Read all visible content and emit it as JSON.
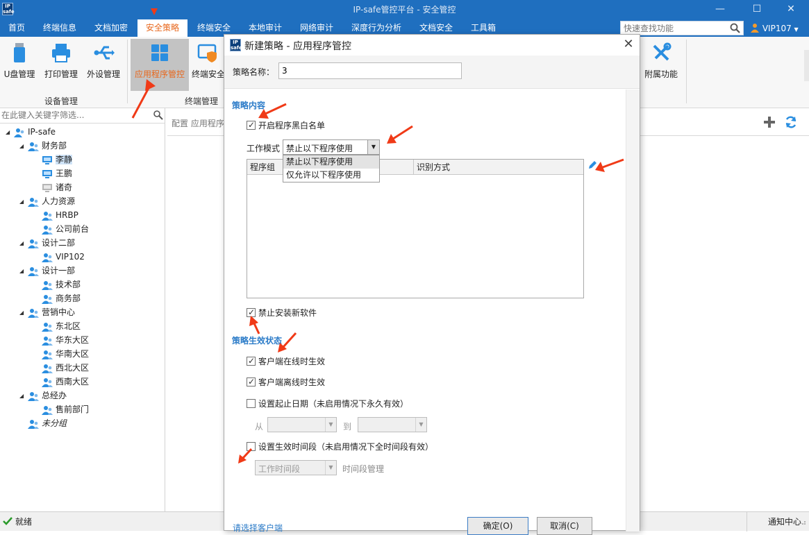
{
  "window": {
    "title": "IP-safe管控平台 - 安全管控",
    "logo": "IP safe"
  },
  "menu": {
    "items": [
      "首页",
      "终端信息",
      "文档加密",
      "安全策略",
      "终端安全",
      "本地审计",
      "网络审计",
      "深度行为分析",
      "文档安全",
      "工具箱"
    ],
    "active": "安全策略"
  },
  "search": {
    "placeholder": "快速查找功能"
  },
  "user": {
    "name": "VIP107"
  },
  "ribbon": {
    "buttons": [
      "U盘管理",
      "打印管理",
      "外设管理",
      "应用程序管控",
      "终端安全",
      "附属功能"
    ],
    "groups": [
      "设备管理",
      "终端管理"
    ]
  },
  "tree": {
    "filter_placeholder": "在此键入关键字筛选...",
    "nodes": [
      {
        "label": "IP-safe",
        "level": 0,
        "icon": "root-icon"
      },
      {
        "label": "财务部",
        "level": 1,
        "icon": "group-icon"
      },
      {
        "label": "李静",
        "level": 2,
        "icon": "computer-icon",
        "selected": true
      },
      {
        "label": "王鹏",
        "level": 2,
        "icon": "computer-icon"
      },
      {
        "label": "诸奇",
        "level": 2,
        "icon": "computer-offline-icon"
      },
      {
        "label": "人力资源",
        "level": 1,
        "icon": "group-icon"
      },
      {
        "label": "HRBP",
        "level": 2,
        "icon": "group-icon"
      },
      {
        "label": "公司前台",
        "level": 2,
        "icon": "group-icon"
      },
      {
        "label": "设计二部",
        "level": 1,
        "icon": "group-icon"
      },
      {
        "label": "VIP102",
        "level": 2,
        "icon": "group-icon"
      },
      {
        "label": "设计一部",
        "level": 1,
        "icon": "group-icon"
      },
      {
        "label": "技术部",
        "level": 2,
        "icon": "group-icon"
      },
      {
        "label": "商务部",
        "level": 2,
        "icon": "group-icon"
      },
      {
        "label": "营销中心",
        "level": 1,
        "icon": "group-icon"
      },
      {
        "label": "东北区",
        "level": 2,
        "icon": "group-icon"
      },
      {
        "label": "华东大区",
        "level": 2,
        "icon": "group-icon"
      },
      {
        "label": "华南大区",
        "level": 2,
        "icon": "group-icon"
      },
      {
        "label": "西北大区",
        "level": 2,
        "icon": "group-icon"
      },
      {
        "label": "西南大区",
        "level": 2,
        "icon": "group-icon"
      },
      {
        "label": "总经办",
        "level": 1,
        "icon": "group-icon"
      },
      {
        "label": "售前部门",
        "level": 2,
        "icon": "group-icon"
      },
      {
        "label": "未分组",
        "level": 1,
        "icon": "group-icon",
        "italic": true
      }
    ]
  },
  "content": {
    "breadcrumb": "配置 应用程序"
  },
  "dialog": {
    "title": "新建策略 - 应用程序管控",
    "name_label": "策略名称：",
    "name_value": "3",
    "section_content": "策略内容",
    "enable_blacklist": "开启程序黑白名单",
    "mode_label": "工作模式",
    "mode_value": "禁止以下程序使用",
    "mode_options": [
      "禁止以下程序使用",
      "仅允许以下程序使用"
    ],
    "columns": [
      "程序组",
      "识别方式"
    ],
    "ban_install": "禁止安装新软件",
    "section_status": "策略生效状态",
    "online": "客户端在线时生效",
    "offline": "客户端离线时生效",
    "set_date": "设置起止日期（未启用情况下永久有效）",
    "from": "从",
    "to": "到",
    "set_time": "设置生效时间段（未启用情况下全时间段有效）",
    "time_value": "工作时间段",
    "time_manage": "时间段管理",
    "select_client": "请选择客户端",
    "ok": "确定(O)",
    "cancel": "取消(C)"
  },
  "status": {
    "ready": "就绪",
    "notice": "通知中心"
  },
  "colors": {
    "accent": "#1f6fbf",
    "active_menu": "#e8671c",
    "section": "#2b7bc8",
    "annotation": "#f03a17"
  }
}
